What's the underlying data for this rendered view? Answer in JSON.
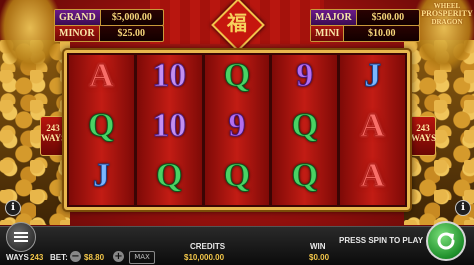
{
  "jackpots": {
    "grand": {
      "label": "GRAND",
      "value": "$5,000.00"
    },
    "minor": {
      "label": "MINOR",
      "value": "$25.00"
    },
    "major": {
      "label": "MAJOR",
      "value": "$500.00"
    },
    "mini": {
      "label": "MINI",
      "value": "$10.00"
    }
  },
  "logo": {
    "line1": "WHEEL",
    "line2": "PROSPERITY",
    "line3": "DRAGON"
  },
  "lantern_glyph": "福",
  "ways_badge": {
    "number": "243",
    "label": "WAYS"
  },
  "reels": [
    [
      "A",
      "Q",
      "J"
    ],
    [
      "10",
      "10",
      "Q"
    ],
    [
      "Q",
      "9",
      "Q"
    ],
    [
      "9",
      "Q",
      "Q"
    ],
    [
      "J",
      "A",
      "A"
    ]
  ],
  "bottom": {
    "ways_label": "WAYS",
    "ways_value": "243",
    "bet_label": "BET:",
    "bet_value": "$8.80",
    "max_label": "MAX",
    "credits_label": "CREDITS",
    "credits_value": "$10,000.00",
    "win_label": "WIN",
    "win_value": "$0.00",
    "prompt": "PRESS SPIN TO PLAY"
  },
  "icons": {
    "menu": "hamburger-icon",
    "spin": "spin-arrow-icon",
    "info": "info-icon"
  }
}
